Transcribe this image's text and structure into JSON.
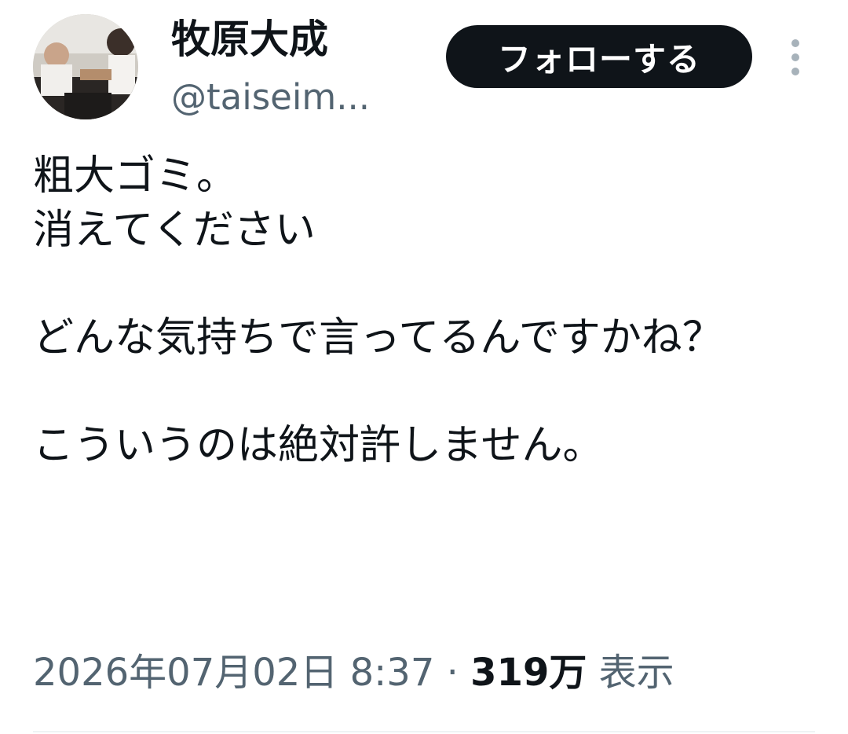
{
  "user": {
    "display_name": "牧原大成",
    "handle": "@taiseim..."
  },
  "header": {
    "follow_label": "フォローする",
    "more_icon": "more-vertical-icon"
  },
  "tweet": {
    "text": "粗大ゴミ。\n消えてください\n\nどんな気持ちで言ってるんですかね？\n\nこういうのは絶対許しません。",
    "timestamp": "2026年07月02日 8:37",
    "separator": "·",
    "views_count": "319万",
    "views_label": "表示"
  },
  "colors": {
    "text_primary": "#0f1419",
    "text_secondary": "#536471",
    "button_bg": "#0f1419",
    "divider": "#eff3f4"
  }
}
